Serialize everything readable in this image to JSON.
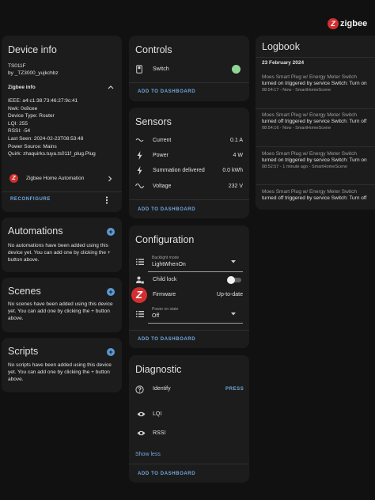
{
  "brand": {
    "name": "zigbee",
    "logo_letter": "Z"
  },
  "device_info": {
    "title": "Device info",
    "model": "TS011F",
    "manufacturer": "by _TZ3000_yujkchbz",
    "zigbee_section_title": "Zigbee info",
    "details": [
      "IEEE: a4:c1:38:73:46:27:9c:41",
      "Nwk: 0x8cee",
      "Device Type: Router",
      "LQI: 255",
      "RSSI: -54",
      "Last Seen: 2024-02-23T08:53:48",
      "Power Source: Mains",
      "Quirk: zhaquirks.tuya.ts011f_plug.Plug"
    ],
    "integration": "Zigbee Home Automation",
    "reconfigure_label": "RECONFIGURE"
  },
  "automations": {
    "title": "Automations",
    "message": "No automations have been added using this device yet. You can add one by clicking the + button above."
  },
  "scenes": {
    "title": "Scenes",
    "message": "No scenes have been added using this device yet. You can add one by clicking the + button above."
  },
  "scripts": {
    "title": "Scripts",
    "message": "No scripts have been added using this device yet. You can add one by clicking the + button above."
  },
  "controls": {
    "title": "Controls",
    "switch_label": "Switch",
    "switch_state": "on",
    "add_label": "ADD TO DASHBOARD"
  },
  "sensors": {
    "title": "Sensors",
    "rows": [
      {
        "label": "Current",
        "value": "0.1 A",
        "icon": "current-icon"
      },
      {
        "label": "Power",
        "value": "4 W",
        "icon": "flash-icon"
      },
      {
        "label": "Summation delivered",
        "value": "0.0 kWh",
        "icon": "flash-icon"
      },
      {
        "label": "Voltage",
        "value": "232 V",
        "icon": "sine-wave-icon"
      }
    ],
    "add_label": "ADD TO DASHBOARD"
  },
  "configuration": {
    "title": "Configuration",
    "backlight_label": "Backlight mode",
    "backlight_value": "LightWhenOn",
    "child_lock_label": "Child lock",
    "child_lock_state": "off",
    "firmware_label": "Firmware",
    "firmware_value": "Up-to-date",
    "power_on_label": "Power on state",
    "power_on_value": "Off",
    "add_label": "ADD TO DASHBOARD"
  },
  "diagnostic": {
    "title": "Diagnostic",
    "identify_label": "Identify",
    "press_label": "PRESS",
    "lqi_label": "LQI",
    "rssi_label": "RSSI",
    "show_less": "Show less",
    "add_label": "ADD TO DASHBOARD"
  },
  "logbook": {
    "title": "Logbook",
    "date": "23 February 2024",
    "entries": [
      {
        "title": "Moes Smart Plug w/ Energy Meter Switch",
        "message": "turned on triggered by service Switch: Turn on",
        "meta": "08:54:17 - Now - SmartHomeScene"
      },
      {
        "title": "Moes Smart Plug w/ Energy Meter Switch",
        "message": "turned off triggered by service Switch: Turn off",
        "meta": "08:54:16 - Now - SmartHomeScene"
      },
      {
        "title": "Moes Smart Plug w/ Energy Meter Switch",
        "message": "turned on triggered by service Switch: Turn on",
        "meta": "08:52:57 - 1 minute ago - SmartHomeScene"
      },
      {
        "title": "Moes Smart Plug w/ Energy Meter Switch",
        "message": "turned off triggered by service Switch: Turn off",
        "meta": ""
      }
    ]
  },
  "colors": {
    "background": "#111111",
    "card": "#1c1c1c",
    "accent": "#72a8e0",
    "switch_on": "#8fd694",
    "zha_red": "#d32f2f"
  }
}
